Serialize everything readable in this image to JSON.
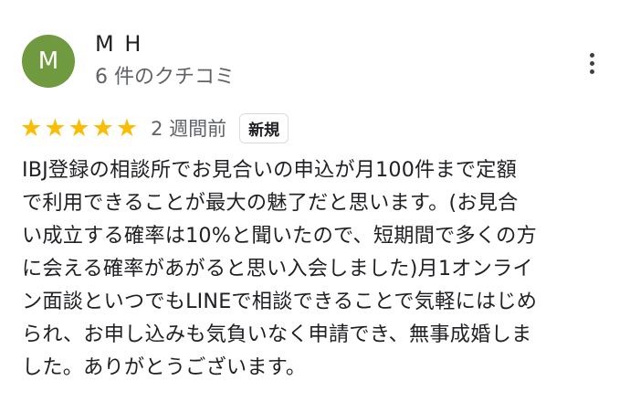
{
  "reviewer": {
    "avatar_letter": "M",
    "avatar_color": "#6f9a3f",
    "name": "M H",
    "review_count": "6 件のクチコミ"
  },
  "review": {
    "rating": 5,
    "max_rating": 5,
    "star_color": "#fbbc04",
    "date": "2 週間前",
    "badge": "新規",
    "lines": [
      "IBJ登録の相談所でお見合いの申込が月100件まで定額",
      "で利用できることが最大の魅了だと思います。(お見合",
      "い成立する確率は10%と聞いたので、短期間で多くの方",
      "に会える確率があがると思い入会しました)月1オンライ",
      "ン面談といつでもLINEで相談できることで気軽にはじめ",
      "られ、お申し込みも気負いなく申請でき、無事成婚しま",
      "した。ありがとうございます。"
    ]
  },
  "icons": {
    "more": "more-vert-icon",
    "star": "star-icon"
  }
}
